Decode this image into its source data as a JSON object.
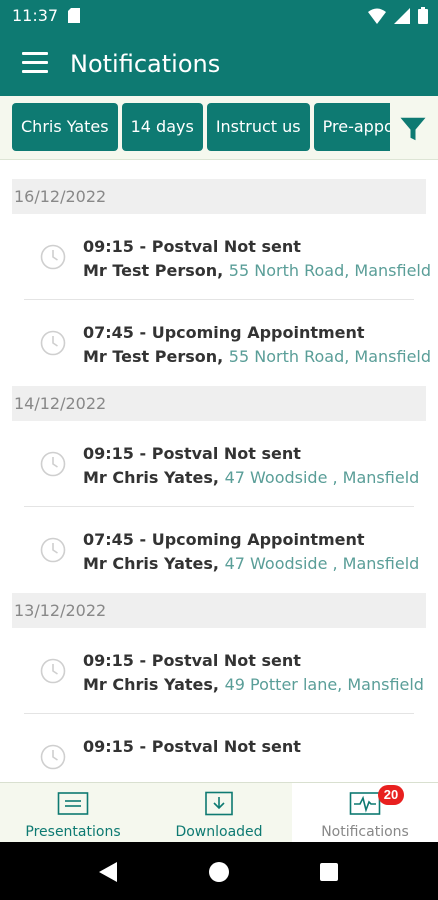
{
  "status_bar": {
    "time": "11:37"
  },
  "app_bar": {
    "title": "Notifications"
  },
  "filters": [
    "Chris Yates",
    "14 days",
    "Instruct us",
    "Pre-appointment"
  ],
  "groups": [
    {
      "date": "16/12/2022",
      "items": [
        {
          "title": "09:15 - Postval Not sent",
          "person": "Mr Test Person",
          "address": "55 North Road, Mansfield"
        },
        {
          "title": "07:45 - Upcoming Appointment",
          "person": "Mr Test Person",
          "address": "55 North Road, Mansfield"
        }
      ]
    },
    {
      "date": "14/12/2022",
      "items": [
        {
          "title": "09:15 - Postval Not sent",
          "person": "Mr Chris Yates",
          "address": "47 Woodside , Mansfield"
        },
        {
          "title": "07:45 - Upcoming Appointment",
          "person": "Mr Chris Yates",
          "address": "47 Woodside , Mansfield"
        }
      ]
    },
    {
      "date": "13/12/2022",
      "items": [
        {
          "title": "09:15 - Postval Not sent",
          "person": "Mr Chris Yates",
          "address": "49 Potter lane, Mansfield"
        },
        {
          "title": "09:15 - Postval Not sent",
          "person": "",
          "address": ""
        }
      ]
    }
  ],
  "bottom_nav": {
    "presentations": "Presentations",
    "downloaded": "Downloaded",
    "notifications": "Notifications",
    "badge": "20"
  },
  "colors": {
    "primary": "#0e7a72",
    "accent_text": "#5a9e98",
    "badge": "#e8201f"
  }
}
